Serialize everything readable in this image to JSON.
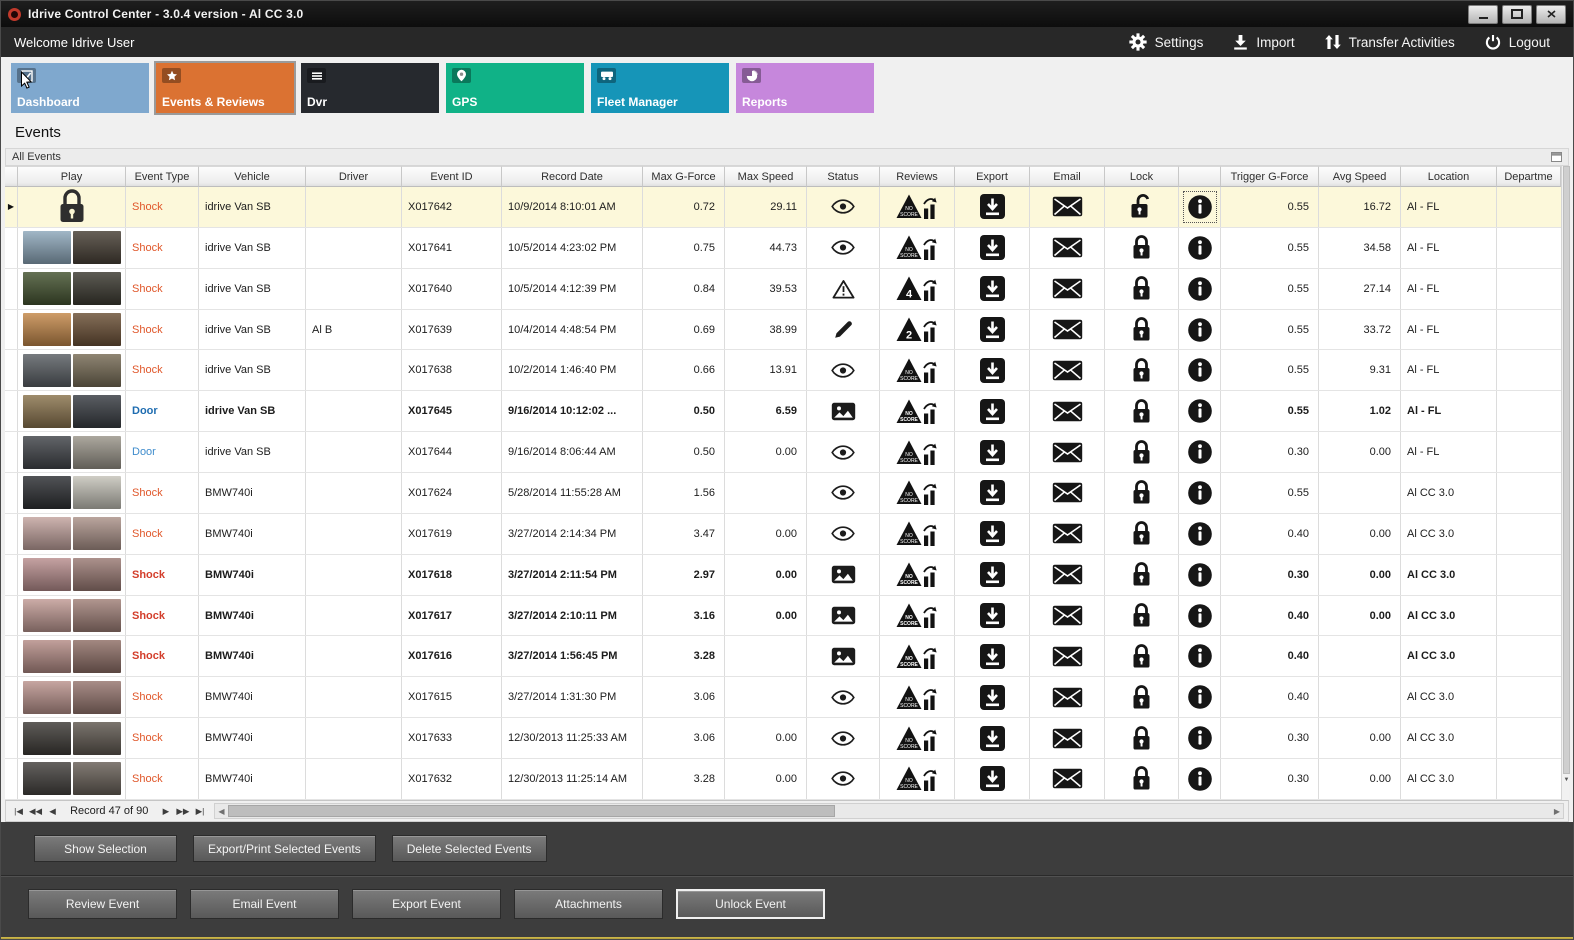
{
  "window": {
    "title": "Idrive Control Center - 3.0.4 version - Al CC 3.0"
  },
  "menubar": {
    "welcome": "Welcome Idrive User",
    "actions": [
      {
        "label": "Settings",
        "icon": "gear"
      },
      {
        "label": "Import",
        "icon": "import"
      },
      {
        "label": "Transfer Activities",
        "icon": "transfer"
      },
      {
        "label": "Logout",
        "icon": "power"
      }
    ]
  },
  "tiles": [
    {
      "label": "Dashboard",
      "color": "#7FA8CE",
      "icon": "dashboard",
      "selected": false
    },
    {
      "label": "Events & Reviews",
      "color": "#DB7232",
      "icon": "events",
      "selected": true
    },
    {
      "label": "Dvr",
      "color": "#26292E",
      "icon": "dvr",
      "selected": false
    },
    {
      "label": "GPS",
      "color": "#10B287",
      "icon": "gps",
      "selected": false
    },
    {
      "label": "Fleet Manager",
      "color": "#1695B8",
      "icon": "fleet",
      "selected": false
    },
    {
      "label": "Reports",
      "color": "#C687DC",
      "icon": "reports",
      "selected": false
    }
  ],
  "page": {
    "title": "Events"
  },
  "group": {
    "label": "All Events"
  },
  "table": {
    "columns": [
      "Play",
      "Event Type",
      "Vehicle",
      "Driver",
      "Event ID",
      "Record Date",
      "Max G-Force",
      "Max Speed",
      "Status",
      "Reviews",
      "Export",
      "Email",
      "Lock",
      "",
      "Trigger G-Force",
      "Avg Speed",
      "Location",
      "Departme"
    ],
    "event_type_colors": {
      "shock": "#E0572A",
      "shock_bold": "#D33E2B",
      "door": "#3F8CCC",
      "door_bold": "#1E6CB0"
    },
    "rows": [
      {
        "selected": true,
        "bold": false,
        "play": "lock",
        "thumb": [],
        "event_type": "Shock",
        "event_type_color": "shock",
        "vehicle": "idrive Van SB",
        "driver": "",
        "event_id": "X017642",
        "record_date": "10/9/2014 8:10:01 AM",
        "max_g": "0.72",
        "max_speed": "29.11",
        "status": "eye",
        "review": "NO SCORE",
        "lock": "unlocked",
        "info_focus": true,
        "trigger_g": "0.55",
        "avg_speed": "16.72",
        "location": "Al - FL",
        "department": ""
      },
      {
        "selected": false,
        "bold": false,
        "play": "thumb",
        "thumb": [
          "#8FA9BC",
          "#4A4238"
        ],
        "event_type": "Shock",
        "event_type_color": "shock",
        "vehicle": "idrive Van SB",
        "driver": "",
        "event_id": "X017641",
        "record_date": "10/5/2014 4:23:02 PM",
        "max_g": "0.75",
        "max_speed": "44.73",
        "status": "eye",
        "review": "NO SCORE",
        "lock": "locked",
        "info_focus": false,
        "trigger_g": "0.55",
        "avg_speed": "34.58",
        "location": "Al - FL",
        "department": ""
      },
      {
        "selected": false,
        "bold": false,
        "play": "thumb",
        "thumb": [
          "#475633",
          "#3E3C33"
        ],
        "event_type": "Shock",
        "event_type_color": "shock",
        "vehicle": "idrive Van SB",
        "driver": "",
        "event_id": "X017640",
        "record_date": "10/5/2014 4:12:39 PM",
        "max_g": "0.84",
        "max_speed": "39.53",
        "status": "warning",
        "review": "4",
        "lock": "locked",
        "info_focus": false,
        "trigger_g": "0.55",
        "avg_speed": "27.14",
        "location": "Al - FL",
        "department": ""
      },
      {
        "selected": false,
        "bold": false,
        "play": "thumb",
        "thumb": [
          "#C58A4C",
          "#6E5339"
        ],
        "event_type": "Shock",
        "event_type_color": "shock",
        "vehicle": "idrive Van SB",
        "driver": "Al B",
        "event_id": "X017639",
        "record_date": "10/4/2014 4:48:54 PM",
        "max_g": "0.69",
        "max_speed": "38.99",
        "status": "pencil",
        "review": "2",
        "lock": "locked",
        "info_focus": false,
        "trigger_g": "0.55",
        "avg_speed": "33.72",
        "location": "Al - FL",
        "department": ""
      },
      {
        "selected": false,
        "bold": false,
        "play": "thumb",
        "thumb": [
          "#5C6166",
          "#796E58"
        ],
        "event_type": "Shock",
        "event_type_color": "shock",
        "vehicle": "idrive Van SB",
        "driver": "",
        "event_id": "X017638",
        "record_date": "10/2/2014 1:46:40 PM",
        "max_g": "0.66",
        "max_speed": "13.91",
        "status": "eye",
        "review": "NO SCORE",
        "lock": "locked",
        "info_focus": false,
        "trigger_g": "0.55",
        "avg_speed": "9.31",
        "location": "Al - FL",
        "department": ""
      },
      {
        "selected": false,
        "bold": true,
        "play": "thumb",
        "thumb": [
          "#8C7650",
          "#3B3F45"
        ],
        "event_type": "Door",
        "event_type_color": "door",
        "vehicle": "idrive Van SB",
        "driver": "",
        "event_id": "X017645",
        "record_date": "9/16/2014 10:12:02 ...",
        "max_g": "0.50",
        "max_speed": "6.59",
        "status": "photo",
        "review": "NO SCORE",
        "lock": "locked",
        "info_focus": false,
        "trigger_g": "0.55",
        "avg_speed": "1.02",
        "location": "Al - FL",
        "department": ""
      },
      {
        "selected": false,
        "bold": false,
        "play": "thumb",
        "thumb": [
          "#44474C",
          "#9C978C"
        ],
        "event_type": "Door",
        "event_type_color": "door",
        "vehicle": "idrive Van SB",
        "driver": "",
        "event_id": "X017644",
        "record_date": "9/16/2014 8:06:44 AM",
        "max_g": "0.50",
        "max_speed": "0.00",
        "status": "eye",
        "review": "NO SCORE",
        "lock": "locked",
        "info_focus": false,
        "trigger_g": "0.30",
        "avg_speed": "0.00",
        "location": "Al - FL",
        "department": ""
      },
      {
        "selected": false,
        "bold": false,
        "play": "thumb",
        "thumb": [
          "#303236",
          "#C6C4BA"
        ],
        "event_type": "Shock",
        "event_type_color": "shock",
        "vehicle": "BMW740i",
        "driver": "",
        "event_id": "X017624",
        "record_date": "5/28/2014 11:55:28 AM",
        "max_g": "1.56",
        "max_speed": "",
        "status": "eye",
        "review": "NO SCORE",
        "lock": "locked",
        "info_focus": false,
        "trigger_g": "0.55",
        "avg_speed": "",
        "location": "Al CC 3.0",
        "department": ""
      },
      {
        "selected": false,
        "bold": false,
        "play": "thumb",
        "thumb": [
          "#C4A5A0",
          "#AD948B"
        ],
        "event_type": "Shock",
        "event_type_color": "shock",
        "vehicle": "BMW740i",
        "driver": "",
        "event_id": "X017619",
        "record_date": "3/27/2014 2:14:34 PM",
        "max_g": "3.47",
        "max_speed": "0.00",
        "status": "eye",
        "review": "NO SCORE",
        "lock": "locked",
        "info_focus": false,
        "trigger_g": "0.40",
        "avg_speed": "0.00",
        "location": "Al CC 3.0",
        "department": ""
      },
      {
        "selected": false,
        "bold": true,
        "play": "thumb",
        "thumb": [
          "#BA9090",
          "#9C7C76"
        ],
        "event_type": "Shock",
        "event_type_color": "shock",
        "vehicle": "BMW740i",
        "driver": "",
        "event_id": "X017618",
        "record_date": "3/27/2014 2:11:54 PM",
        "max_g": "2.97",
        "max_speed": "0.00",
        "status": "photo",
        "review": "NO SCORE",
        "lock": "locked",
        "info_focus": false,
        "trigger_g": "0.30",
        "avg_speed": "0.00",
        "location": "Al CC 3.0",
        "department": ""
      },
      {
        "selected": false,
        "bold": true,
        "play": "thumb",
        "thumb": [
          "#C29C96",
          "#A2827A"
        ],
        "event_type": "Shock",
        "event_type_color": "shock",
        "vehicle": "BMW740i",
        "driver": "",
        "event_id": "X017617",
        "record_date": "3/27/2014 2:10:11 PM",
        "max_g": "3.16",
        "max_speed": "0.00",
        "status": "photo",
        "review": "NO SCORE",
        "lock": "locked",
        "info_focus": false,
        "trigger_g": "0.40",
        "avg_speed": "0.00",
        "location": "Al CC 3.0",
        "department": ""
      },
      {
        "selected": false,
        "bold": true,
        "play": "thumb",
        "thumb": [
          "#B68E88",
          "#917169"
        ],
        "event_type": "Shock",
        "event_type_color": "shock",
        "vehicle": "BMW740i",
        "driver": "",
        "event_id": "X017616",
        "record_date": "3/27/2014 1:56:45 PM",
        "max_g": "3.28",
        "max_speed": "",
        "status": "photo",
        "review": "NO SCORE",
        "lock": "locked",
        "info_focus": false,
        "trigger_g": "0.40",
        "avg_speed": "",
        "location": "Al CC 3.0",
        "department": ""
      },
      {
        "selected": false,
        "bold": false,
        "play": "thumb",
        "thumb": [
          "#BC958F",
          "#987871"
        ],
        "event_type": "Shock",
        "event_type_color": "shock",
        "vehicle": "BMW740i",
        "driver": "",
        "event_id": "X017615",
        "record_date": "3/27/2014 1:31:30 PM",
        "max_g": "3.06",
        "max_speed": "",
        "status": "eye",
        "review": "NO SCORE",
        "lock": "locked",
        "info_focus": false,
        "trigger_g": "0.40",
        "avg_speed": "",
        "location": "Al CC 3.0",
        "department": ""
      },
      {
        "selected": false,
        "bold": false,
        "play": "thumb",
        "thumb": [
          "#403D39",
          "#615A52"
        ],
        "event_type": "Shock",
        "event_type_color": "shock",
        "vehicle": "BMW740i",
        "driver": "",
        "event_id": "X017633",
        "record_date": "12/30/2013 11:25:33 AM",
        "max_g": "3.06",
        "max_speed": "0.00",
        "status": "eye",
        "review": "NO SCORE",
        "lock": "locked",
        "info_focus": false,
        "trigger_g": "0.30",
        "avg_speed": "0.00",
        "location": "Al CC 3.0",
        "department": ""
      },
      {
        "selected": false,
        "bold": false,
        "play": "thumb",
        "thumb": [
          "#464340",
          "#6A625A"
        ],
        "event_type": "Shock",
        "event_type_color": "shock",
        "vehicle": "BMW740i",
        "driver": "",
        "event_id": "X017632",
        "record_date": "12/30/2013 11:25:14 AM",
        "max_g": "3.28",
        "max_speed": "0.00",
        "status": "eye",
        "review": "NO SCORE",
        "lock": "locked",
        "info_focus": false,
        "trigger_g": "0.30",
        "avg_speed": "0.00",
        "location": "Al CC 3.0",
        "department": ""
      }
    ]
  },
  "pager": {
    "left_buttons": [
      "|◀",
      "◀◀",
      "◀"
    ],
    "record_text": "Record 47 of 90",
    "right_buttons": [
      "▶",
      "▶▶",
      "▶|"
    ]
  },
  "selection_actions": [
    "Show Selection",
    "Export/Print Selected Events",
    "Delete Selected  Events"
  ],
  "event_actions": [
    {
      "label": "Review Event",
      "focused": false
    },
    {
      "label": "Email Event",
      "focused": false
    },
    {
      "label": "Export Event",
      "focused": false
    },
    {
      "label": "Attachments",
      "focused": false
    },
    {
      "label": "Unlock Event",
      "focused": true
    }
  ]
}
